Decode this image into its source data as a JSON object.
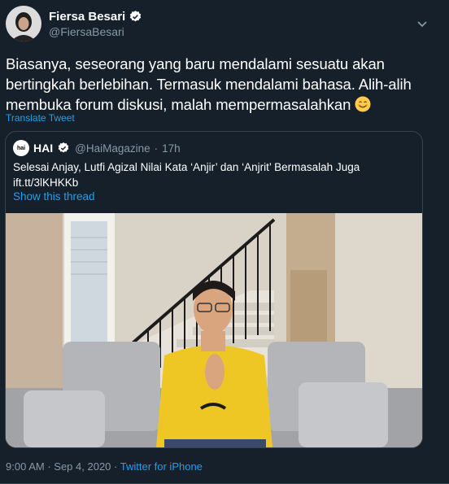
{
  "tweet": {
    "author_name": "Fiersa Besari",
    "handle": "@FiersaBesari",
    "text": "Biasanya, seseorang yang baru mendalami sesuatu akan bertingkah berlebihan. Termasuk mendalami bahasa. Alih-alih membuka forum diskusi, malah mempermasalahkan",
    "translate_label": "Translate Tweet",
    "time": "9:00 AM",
    "date": "Sep 4, 2020",
    "source": "Twitter for iPhone"
  },
  "quote": {
    "logo_text": "hai",
    "name": "HAI",
    "handle": "@HaiMagazine",
    "age": "17h",
    "text_line1": "Selesai Anjay, Lutfi Agizal Nilai Kata ‘Anjir’ dan ‘Anjrit’ Bermasalah Juga",
    "text_line2": "ift.tt/3lKHKKb",
    "show_thread": "Show this thread"
  },
  "colors": {
    "background": "#15202b",
    "link": "#1da1f2",
    "secondary": "#8899a6",
    "border": "#38444d",
    "verified": "#ffffff"
  },
  "icons": {
    "verified": "verified-badge-icon",
    "caret": "chevron-down-icon",
    "emoji": "smiling-face-emoji"
  }
}
